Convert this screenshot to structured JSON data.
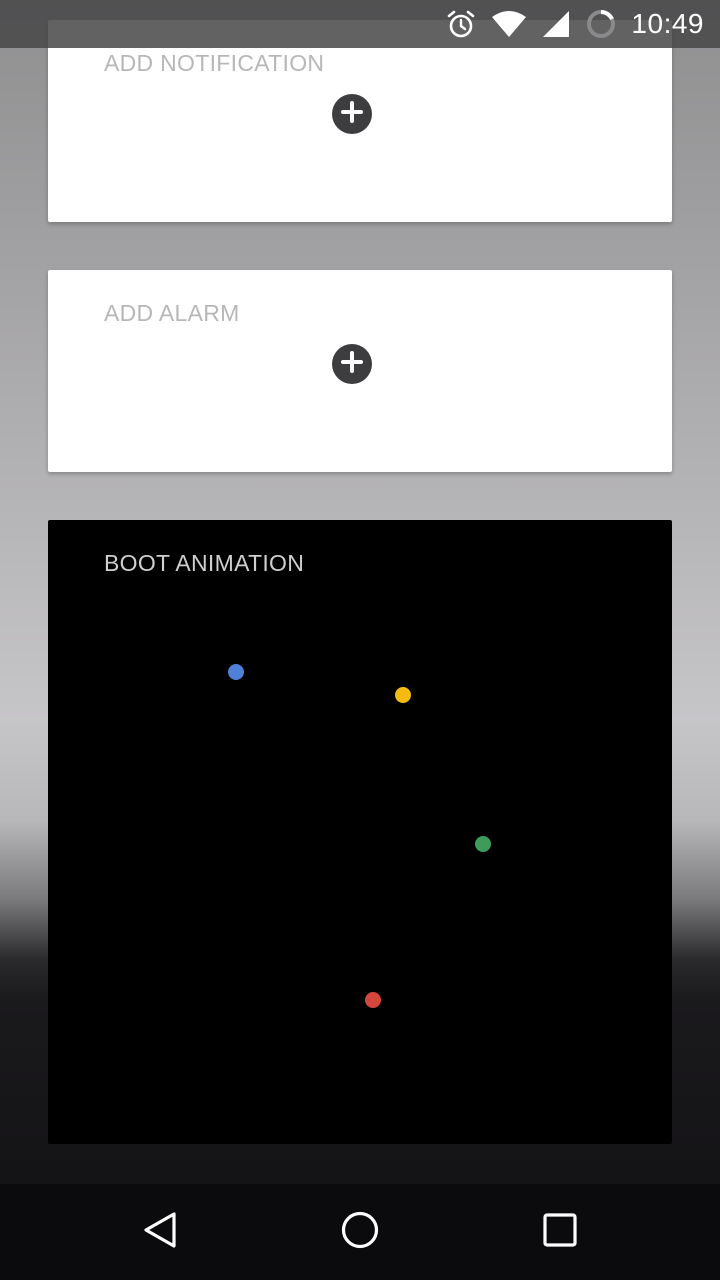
{
  "status_bar": {
    "time": "10:49",
    "icons": [
      "alarm-clock-icon",
      "wifi-icon",
      "cell-signal-icon",
      "battery-charging-ring-icon"
    ],
    "color": "#ffffff"
  },
  "cards": {
    "notification": {
      "title": "ADD NOTIFICATION",
      "button_icon": "plus-circle-icon"
    },
    "alarm": {
      "title": "ADD ALARM",
      "button_icon": "plus-circle-icon"
    },
    "boot_animation": {
      "title": "BOOT ANIMATION",
      "dots": [
        {
          "color": "#4f7fd6",
          "name": "blue"
        },
        {
          "color": "#f5bb12",
          "name": "yellow"
        },
        {
          "color": "#3e9b5a",
          "name": "green"
        },
        {
          "color": "#d5473e",
          "name": "red"
        }
      ]
    }
  },
  "nav_bar": {
    "icons": [
      "back-triangle-icon",
      "home-circle-icon",
      "recents-square-icon"
    ]
  },
  "colors": {
    "button_bg": "#3d3d40",
    "card_title_light": "#b7b7b9",
    "card_title_dark": "#cfcfd1"
  }
}
